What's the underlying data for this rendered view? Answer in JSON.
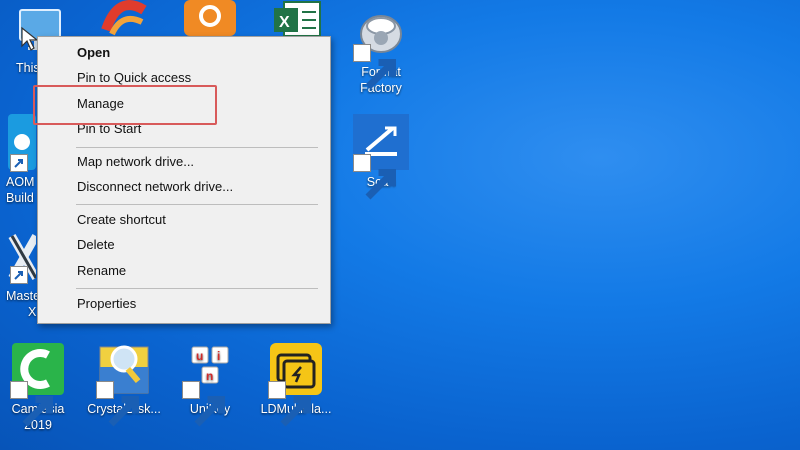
{
  "desktop": {
    "partial_labels": {
      "this_pc": "This",
      "aom": "AOM",
      "build": "Build",
      "master": "Maste",
      "x": "X"
    },
    "icons": [
      {
        "id": "format-factory",
        "lines": [
          "Format",
          "Factory"
        ],
        "icon": "format-factory-icon"
      },
      {
        "id": "scan",
        "lines": [
          "Scan"
        ],
        "icon": "scan-icon"
      },
      {
        "id": "camtasia",
        "lines": [
          "Camtasia",
          "2019"
        ],
        "icon": "camtasia-icon"
      },
      {
        "id": "crystaldisk",
        "lines": [
          "CrystalDisk..."
        ],
        "icon": "crystaldisk-icon"
      },
      {
        "id": "unikey",
        "lines": [
          "UniKey"
        ],
        "icon": "unikey-icon"
      },
      {
        "id": "ldmultiplayer",
        "lines": [
          "LDMultiPla..."
        ],
        "icon": "ldmultiplayer-icon"
      }
    ],
    "background_color": "#137ae6"
  },
  "context_menu": {
    "items": [
      {
        "label": "Open",
        "bold": true
      },
      {
        "label": "Pin to Quick access"
      },
      {
        "label": "Manage",
        "highlighted": true
      },
      {
        "label": "Pin to Start"
      },
      {
        "label": "Map network drive..."
      },
      {
        "label": "Disconnect network drive..."
      },
      {
        "label": "Create shortcut"
      },
      {
        "label": "Delete"
      },
      {
        "label": "Rename"
      },
      {
        "label": "Properties"
      }
    ],
    "highlight_color": "#d85a5a"
  }
}
